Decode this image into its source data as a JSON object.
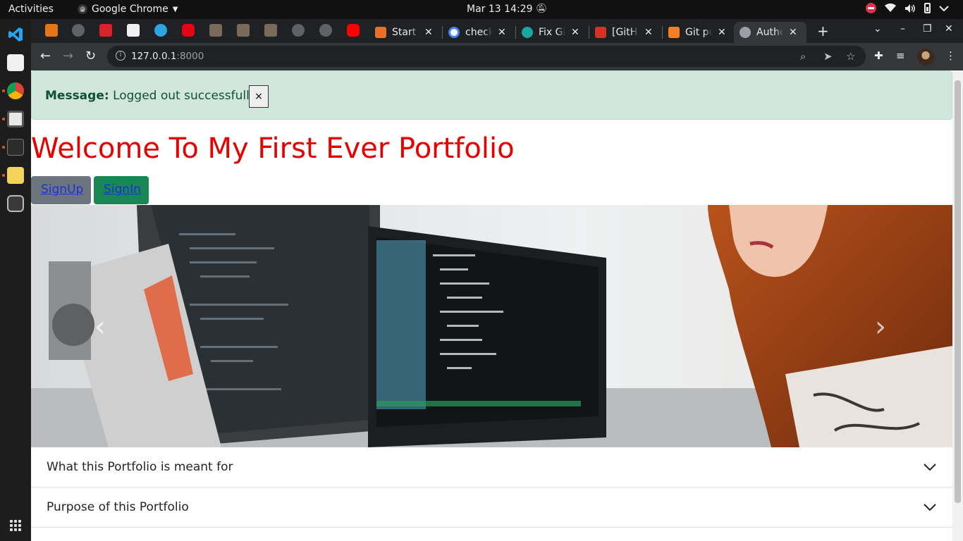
{
  "system": {
    "activities": "Activities",
    "app_name": "Google Chrome",
    "clock": "Mar 13  14:29"
  },
  "tabs": [
    {
      "title": "Start u",
      "favicon": "boxes-icon",
      "color": "#e8702a"
    },
    {
      "title": "check",
      "favicon": "google-icon",
      "color": "#4285f4"
    },
    {
      "title": "Fix Gi",
      "favicon": "eye-icon",
      "color": "#19a6a0"
    },
    {
      "title": "[GitH",
      "favicon": "gmail-icon",
      "color": "#d93025"
    },
    {
      "title": "Git pu",
      "favicon": "stackoverflow-icon",
      "color": "#f48024"
    },
    {
      "title": "Authe",
      "favicon": "globe-icon",
      "color": "#9aa0a6",
      "active": true
    }
  ],
  "browser": {
    "url_host": "127.0.0.1",
    "url_port": ":8000"
  },
  "page": {
    "alert_label": "Message:",
    "alert_text": "Logged out successfully...",
    "alert_close": "×",
    "title": "Welcome To My First Ever Portfolio",
    "signup_label": "SignUp",
    "signin_label": "SignIn",
    "carousel_prev": "‹",
    "carousel_next": "›",
    "accordion": [
      {
        "label": "What this Portfolio is meant for"
      },
      {
        "label": "Purpose of this Portfolio"
      }
    ]
  },
  "colors": {
    "title": "#e60000",
    "alert_bg": "#d1e7dd",
    "signup_bg": "#6c757d",
    "signin_bg": "#198754",
    "link": "#1a31d9"
  }
}
